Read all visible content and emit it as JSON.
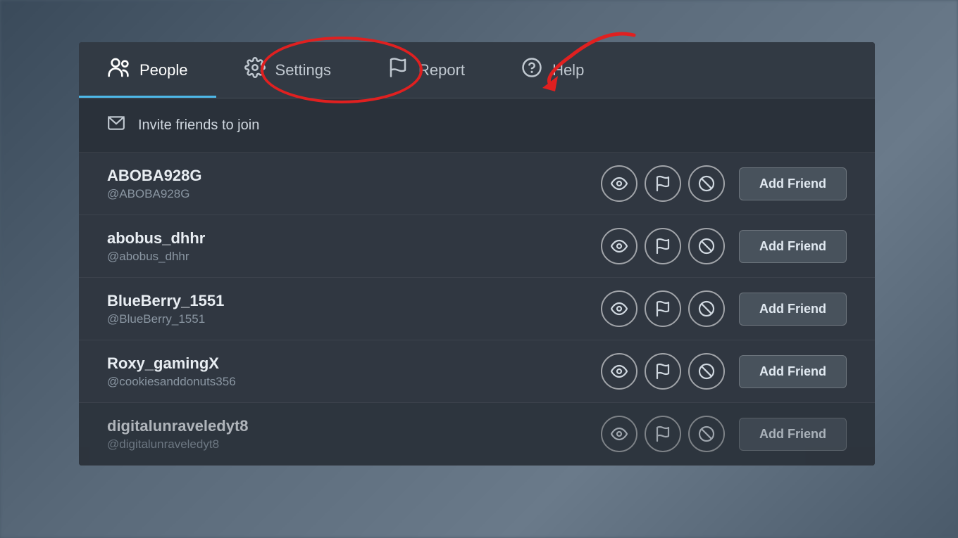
{
  "tabs": [
    {
      "id": "people",
      "label": "People",
      "active": true
    },
    {
      "id": "settings",
      "label": "Settings",
      "active": false
    },
    {
      "id": "report",
      "label": "Report",
      "active": false
    },
    {
      "id": "help",
      "label": "Help",
      "active": false
    }
  ],
  "invite": {
    "label": "Invite friends to join"
  },
  "users": [
    {
      "name": "ABOBA928G",
      "handle": "@ABOBA928G",
      "addFriendLabel": "Add Friend"
    },
    {
      "name": "abobus_dhhr",
      "handle": "@abobus_dhhr",
      "addFriendLabel": "Add Friend"
    },
    {
      "name": "BlueBerry_1551",
      "handle": "@BlueBerry_1551",
      "addFriendLabel": "Add Friend"
    },
    {
      "name": "Roxy_gamingX",
      "handle": "@cookiesanddonuts356",
      "addFriendLabel": "Add Friend"
    },
    {
      "name": "digitalunraveledyt8",
      "handle": "@digitalunraveledyt8",
      "addFriendLabel": "Add Friend"
    }
  ]
}
